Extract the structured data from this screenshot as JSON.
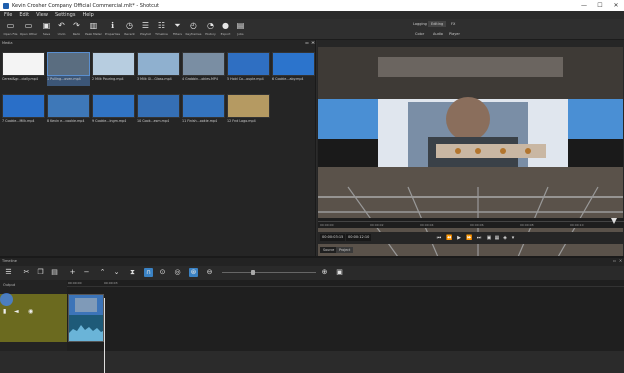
{
  "window": {
    "title": "Kevin Crosher Company Official Commercial.mlt* - Shotcut",
    "minimize": "—",
    "maximize": "☐",
    "close": "✕"
  },
  "menu": [
    "File",
    "Edit",
    "View",
    "Settings",
    "Help"
  ],
  "toolbar": {
    "buttons": [
      {
        "label": "Open File",
        "icon": "folder-open-icon"
      },
      {
        "label": "Open Other",
        "icon": "folder-other-icon"
      },
      {
        "label": "Save",
        "icon": "save-icon"
      },
      {
        "label": "Undo",
        "icon": "undo-icon"
      },
      {
        "label": "Redo",
        "icon": "redo-icon"
      },
      {
        "label": "Peak Meter",
        "icon": "peak-meter-icon"
      },
      {
        "label": "Properties",
        "icon": "info-icon"
      },
      {
        "label": "Recent",
        "icon": "clock-icon"
      },
      {
        "label": "Playlist",
        "icon": "playlist-icon"
      },
      {
        "label": "Timeline",
        "icon": "timeline-icon"
      },
      {
        "label": "Filters",
        "icon": "filter-icon"
      },
      {
        "label": "Keyframes",
        "icon": "keyframes-icon"
      },
      {
        "label": "History",
        "icon": "history-icon"
      },
      {
        "label": "Export",
        "icon": "export-icon"
      },
      {
        "label": "Jobs",
        "icon": "jobs-icon"
      }
    ],
    "layouts": {
      "row1": [
        "Logging",
        "Editing",
        "FX"
      ],
      "row2": [
        "Color",
        "Audio",
        "Player"
      ]
    }
  },
  "media_panel": {
    "title": "Media",
    "clips": [
      {
        "label": "Cereal&gr...cially.mp4",
        "color": "#f4f4f4"
      },
      {
        "label": "1 Pulling...oven.mp4",
        "color": "#5a6d80"
      },
      {
        "label": "2 Milk Pouring.mp4",
        "color": "#b7cde0"
      },
      {
        "label": "3 Milk Gl...Glass.mp4",
        "color": "#8fb0cf"
      },
      {
        "label": "4 Grabbin...okies.MP4",
        "color": "#7a8ea3"
      },
      {
        "label": "5 Hold Co...ouple.mp4",
        "color": "#2f6fc2"
      },
      {
        "label": "6 Cookie...aby.mp4",
        "color": "#2c74cc"
      },
      {
        "label": "7 Cookie...Milk.mp4",
        "color": "#2a6fc8"
      },
      {
        "label": "8 Kevin e...cookie.mp4",
        "color": "#3e78b8"
      },
      {
        "label": "9 Cookie...ingm.mp4",
        "color": "#3174c4"
      },
      {
        "label": "10 Cook...esm.mp4",
        "color": "#356fb5"
      },
      {
        "label": "11 Finish...ookie.mp4",
        "color": "#3474bf"
      },
      {
        "label": "12 Fnd Logo.mp4",
        "color": "#b59a62"
      }
    ],
    "bottom_icons": [
      "add-icon",
      "remove-icon",
      "check-icon",
      "list-view-icon",
      "tile-view-icon",
      "icon-view-icon",
      "delete-icon"
    ]
  },
  "player": {
    "timecode_current": "00:00:03:15",
    "timecode_total": "00:00:12:10",
    "ruler_marks": [
      "00:00:00",
      "00:00:02",
      "00:00:04",
      "00:00:06",
      "00:00:08",
      "00:00:10"
    ],
    "tabs": [
      "Source",
      "Project"
    ],
    "active_tab": "Project"
  },
  "timeline": {
    "title": "Timeline",
    "track_name": "Output",
    "ruler_marks": [
      "00:00:00",
      "00:00:03"
    ],
    "zoom_level": 0.3
  },
  "colors": {
    "accent": "#3a82c4",
    "track": "#6b6a1f",
    "clip": "#2a5ea8"
  }
}
